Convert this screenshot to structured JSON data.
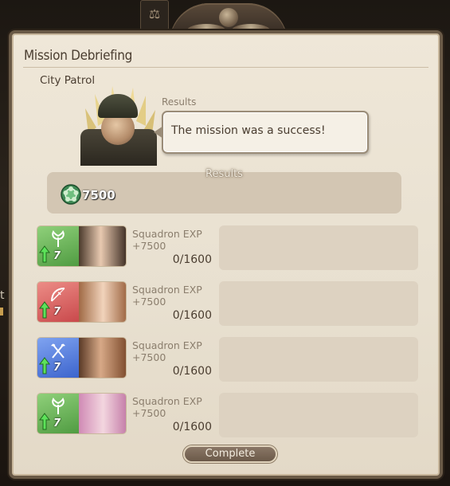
{
  "window": {
    "title": "Mission Debriefing",
    "mission_name": "City Patrol"
  },
  "message": {
    "speaker_tag": "Results",
    "text": "The mission was a success!"
  },
  "results": {
    "label": "Results",
    "reward_value": "7500",
    "reward_icon": "company-seal-icon"
  },
  "members": [
    {
      "class": "conjurer",
      "class_color": "#5fa64a",
      "rank": "7",
      "exp_label": "Squadron EXP",
      "exp_gain": "+7500",
      "exp_progress": "0/1600"
    },
    {
      "class": "archer",
      "class_color": "#d8595a",
      "rank": "7",
      "exp_label": "Squadron EXP",
      "exp_gain": "+7500",
      "exp_progress": "0/1600"
    },
    {
      "class": "marauder",
      "class_color": "#3f6bd4",
      "rank": "7",
      "exp_label": "Squadron EXP",
      "exp_gain": "+7500",
      "exp_progress": "0/1600"
    },
    {
      "class": "conjurer",
      "class_color": "#5fa64a",
      "rank": "7",
      "exp_label": "Squadron EXP",
      "exp_gain": "+7500",
      "exp_progress": "0/1600"
    }
  ],
  "buttons": {
    "complete": "Complete"
  },
  "background": {
    "partial_text": "t"
  }
}
